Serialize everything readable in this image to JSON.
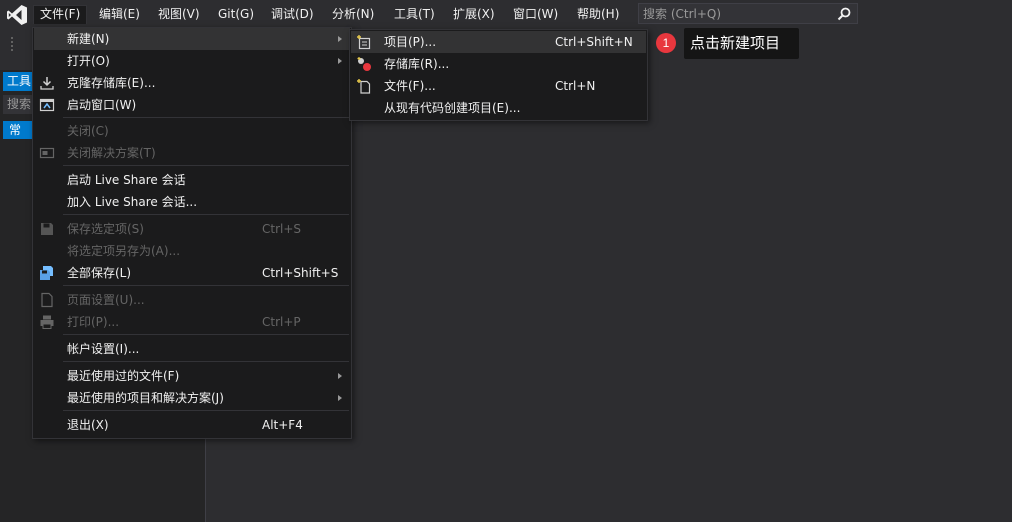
{
  "menubar": {
    "items": [
      "文件(F)",
      "编辑(E)",
      "视图(V)",
      "Git(G)",
      "调试(D)",
      "分析(N)",
      "工具(T)",
      "扩展(X)",
      "窗口(W)",
      "帮助(H)"
    ],
    "search_placeholder": "搜索 (Ctrl+Q)"
  },
  "toolbox": {
    "title": "工具",
    "search": "搜索",
    "node": "常"
  },
  "file_menu": {
    "items": [
      {
        "label": "新建(N)",
        "shortcut": "",
        "icon": "new-icon",
        "disabled": false,
        "submenu": true
      },
      {
        "label": "打开(O)",
        "shortcut": "",
        "icon": "",
        "disabled": false,
        "submenu": true
      },
      {
        "label": "克隆存储库(E)...",
        "shortcut": "",
        "icon": "download-icon",
        "disabled": false,
        "submenu": false
      },
      {
        "label": "启动窗口(W)",
        "shortcut": "",
        "icon": "start-window-icon",
        "disabled": false,
        "submenu": false
      },
      {
        "label": "关闭(C)",
        "shortcut": "",
        "icon": "",
        "disabled": true,
        "submenu": false
      },
      {
        "label": "关闭解决方案(T)",
        "shortcut": "",
        "icon": "close-solution-icon",
        "disabled": true,
        "submenu": false
      },
      {
        "label": "启动 Live Share 会话",
        "shortcut": "",
        "icon": "",
        "disabled": false,
        "submenu": false
      },
      {
        "label": "加入 Live Share 会话...",
        "shortcut": "",
        "icon": "",
        "disabled": false,
        "submenu": false
      },
      {
        "label": "保存选定项(S)",
        "shortcut": "Ctrl+S",
        "icon": "save-icon",
        "disabled": true,
        "submenu": false
      },
      {
        "label": "将选定项另存为(A)...",
        "shortcut": "",
        "icon": "",
        "disabled": true,
        "submenu": false
      },
      {
        "label": "全部保存(L)",
        "shortcut": "Ctrl+Shift+S",
        "icon": "save-all-icon",
        "disabled": false,
        "submenu": false
      },
      {
        "label": "页面设置(U)...",
        "shortcut": "",
        "icon": "page-setup-icon",
        "disabled": true,
        "submenu": false
      },
      {
        "label": "打印(P)...",
        "shortcut": "Ctrl+P",
        "icon": "print-icon",
        "disabled": true,
        "submenu": false
      },
      {
        "label": "帐户设置(I)...",
        "shortcut": "",
        "icon": "",
        "disabled": false,
        "submenu": false
      },
      {
        "label": "最近使用过的文件(F)",
        "shortcut": "",
        "icon": "",
        "disabled": false,
        "submenu": true
      },
      {
        "label": "最近使用的项目和解决方案(J)",
        "shortcut": "",
        "icon": "",
        "disabled": false,
        "submenu": true
      },
      {
        "label": "退出(X)",
        "shortcut": "Alt+F4",
        "icon": "",
        "disabled": false,
        "submenu": false
      }
    ]
  },
  "new_submenu": {
    "items": [
      {
        "label": "项目(P)...",
        "shortcut": "Ctrl+Shift+N",
        "icon": "new-project-icon"
      },
      {
        "label": "存储库(R)...",
        "shortcut": "",
        "icon": "repository-icon"
      },
      {
        "label": "文件(F)...",
        "shortcut": "Ctrl+N",
        "icon": "new-file-icon"
      },
      {
        "label": "从现有代码创建项目(E)...",
        "shortcut": "",
        "icon": ""
      }
    ]
  },
  "annotation": {
    "step": "1",
    "text": "点击新建项目"
  },
  "colors": {
    "background": "#2d2d30",
    "menu_background": "#1b1b1c",
    "highlight": "#333334",
    "accent": "#007acc",
    "badge": "#e8373e",
    "logo": "#865fc5"
  }
}
